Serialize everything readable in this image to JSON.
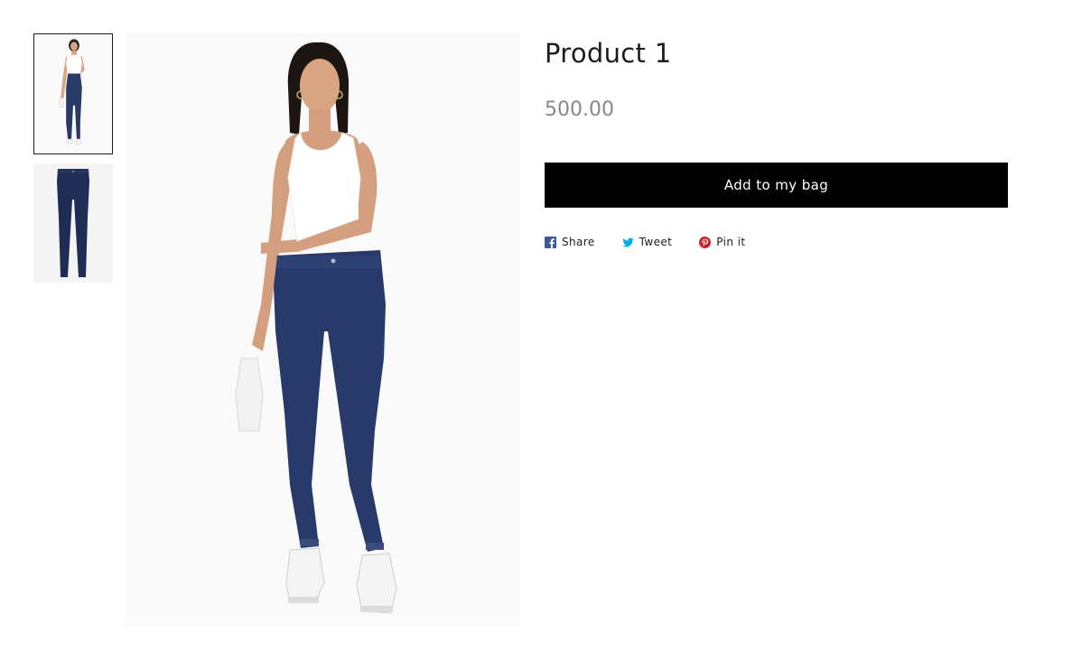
{
  "product": {
    "title": "Product 1",
    "price": "500.00",
    "add_to_bag_label": "Add to my bag"
  },
  "gallery": {
    "thumbnails": [
      {
        "name": "model-full-body",
        "selected": true
      },
      {
        "name": "jeans-flat-lay",
        "selected": false
      }
    ]
  },
  "share": {
    "items": [
      {
        "label": "Share",
        "icon": "facebook-icon",
        "color": "#3b5998"
      },
      {
        "label": "Tweet",
        "icon": "twitter-icon",
        "color": "#00aced"
      },
      {
        "label": "Pin it",
        "icon": "pinterest-icon",
        "color": "#cb2027"
      }
    ]
  },
  "colors": {
    "button_bg": "#000000",
    "button_text": "#ffffff",
    "price": "#888888",
    "title": "#1c1d1d"
  }
}
